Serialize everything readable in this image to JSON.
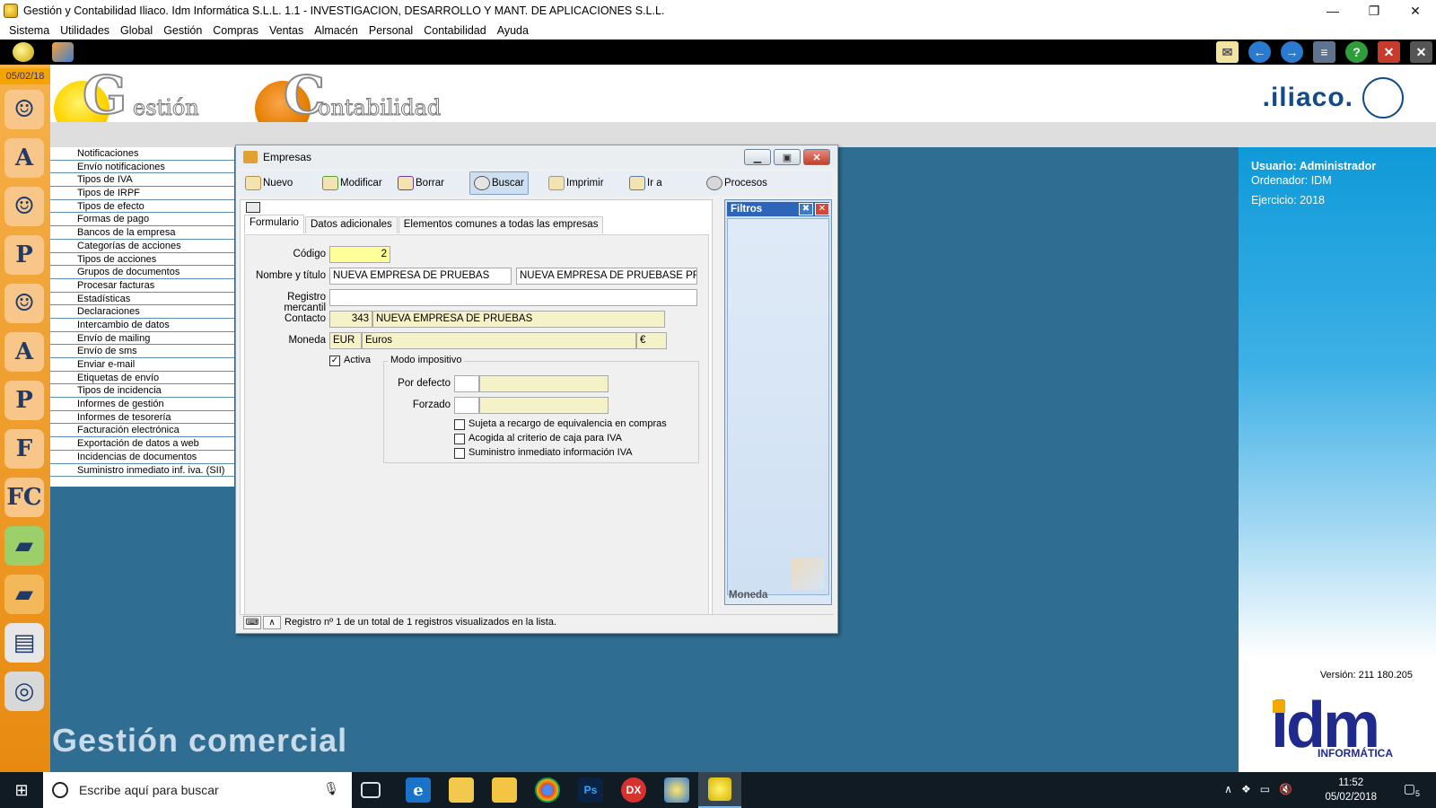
{
  "window": {
    "title": "Gestión y Contabilidad Iliaco. Idm Informática S.L.L. 1.1 - INVESTIGACION, DESARROLLO Y MANT. DE APLICACIONES S.L.L."
  },
  "menu": [
    "Sistema",
    "Utilidades",
    "Global",
    "Gestión",
    "Compras",
    "Ventas",
    "Almacén",
    "Personal",
    "Contabilidad",
    "Ayuda"
  ],
  "sidebar": {
    "date": "05/02/18"
  },
  "header": {
    "gestion_initial": "G",
    "gestion_rest": "estión",
    "contab_initial": "C",
    "contab_rest": "ontabilidad",
    "brand": ".iliaco."
  },
  "submenu": [
    "Notificaciones",
    "Envío notificaciones",
    "Tipos de IVA",
    "Tipos de IRPF",
    "Tipos de efecto",
    "Formas de pago",
    "Bancos de la empresa",
    "Categorías de acciones",
    "Tipos de acciones",
    "Grupos de documentos",
    "Procesar facturas",
    "Estadísticas",
    "Declaraciones",
    "Intercambio de datos",
    "Envío de mailing",
    "Envío de sms",
    "Enviar e-mail",
    "Etiquetas de envío",
    "Tipos de incidencia",
    "Informes de gestión",
    "Informes de tesorería",
    "Facturación electrónica",
    "Exportación de datos a web",
    "Incidencias de documentos",
    "Suministro inmediato inf. iva. (SII)"
  ],
  "background_text": "Gestión comercial",
  "info": {
    "usuario": "Usuario: Administrador",
    "ordenador": "Ordenador: IDM",
    "ejercicio": "Ejercicio: 2018",
    "version": "Versión: 211 180.205",
    "idm_logo": "idm",
    "idm_sub": "INFORMÁTICA"
  },
  "dialog": {
    "title": "Empresas",
    "toolbar": {
      "nuevo": "Nuevo",
      "modificar": "Modificar",
      "borrar": "Borrar",
      "buscar": "Buscar",
      "imprimir": "Imprimir",
      "ir_a": "Ir a",
      "procesos": "Procesos"
    },
    "tabs": [
      "Formulario",
      "Datos adicionales",
      "Elementos comunes a todas las empresas"
    ],
    "form": {
      "codigo_label": "Código",
      "codigo_value": "2",
      "nombre_label": "Nombre y título",
      "nombre_value": "NUEVA EMPRESA DE PRUEBAS",
      "titulo_value": "NUEVA EMPRESA DE PRUEBASE PRI",
      "registro_label": "Registro mercantil",
      "registro_value": "",
      "contacto_label": "Contacto",
      "contacto_code": "343",
      "contacto_name": "NUEVA EMPRESA DE PRUEBAS",
      "moneda_label": "Moneda",
      "moneda_code": "EUR",
      "moneda_name": "Euros",
      "moneda_symbol": "€",
      "activa_label": "Activa",
      "activa_checked": true,
      "modo_title": "Modo impositivo",
      "por_defecto_label": "Por defecto",
      "forzado_label": "Forzado",
      "chk1": "Sujeta a recargo de equivalencia en compras",
      "chk2": "Acogida al criterio de caja para IVA",
      "chk3": "Suministro inmediato información IVA"
    },
    "filtros": {
      "title": "Filtros",
      "footer": "Moneda"
    },
    "status": "Registro nº 1 de un total de 1 registros visualizados en la lista."
  },
  "taskbar": {
    "search_placeholder": "Escribe aquí para buscar",
    "time": "11:52",
    "date": "05/02/2018",
    "notifications": "5"
  },
  "colors": {
    "accent_orange": "#e88a10",
    "info_panel": "#0f9ad8",
    "desktop": "#2f6d92",
    "idm_blue": "#1f2a8c"
  }
}
